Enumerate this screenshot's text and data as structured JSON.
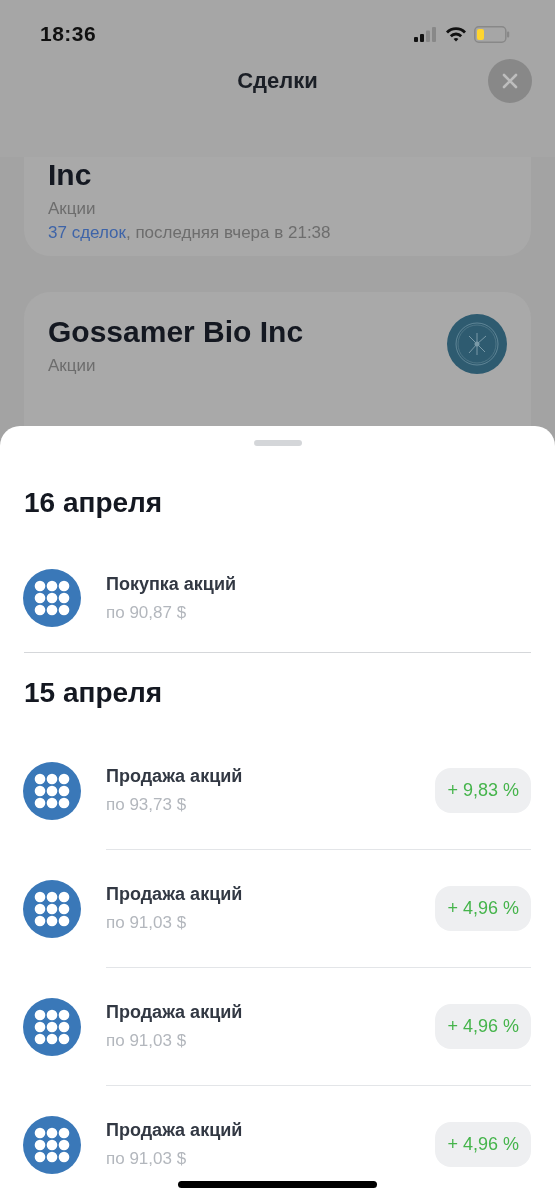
{
  "status_bar": {
    "time": "18:36"
  },
  "header": {
    "title": "Сделки"
  },
  "background_cards": [
    {
      "title": "Inc",
      "category": "Акции",
      "deals_link": "37 сделок",
      "deals_rest": ", последняя вчера в 21:38",
      "logo": false
    },
    {
      "title": "Gossamer Bio Inc",
      "category": "Акции",
      "logo": true
    }
  ],
  "sheet": {
    "groups": [
      {
        "date": "16 апреля",
        "operations": [
          {
            "title": "Покупка акций",
            "price": "по 90,87 $"
          }
        ]
      },
      {
        "date": "15 апреля",
        "operations": [
          {
            "title": "Продажа акций",
            "price": "по 93,73 $",
            "change": "+ 9,83 %"
          },
          {
            "title": "Продажа акций",
            "price": "по 91,03 $",
            "change": "+ 4,96 %"
          },
          {
            "title": "Продажа акций",
            "price": "по 91,03 $",
            "change": "+ 4,96 %"
          },
          {
            "title": "Продажа акций",
            "price": "по 91,03 $",
            "change": "+ 4,96 %"
          }
        ]
      }
    ]
  }
}
